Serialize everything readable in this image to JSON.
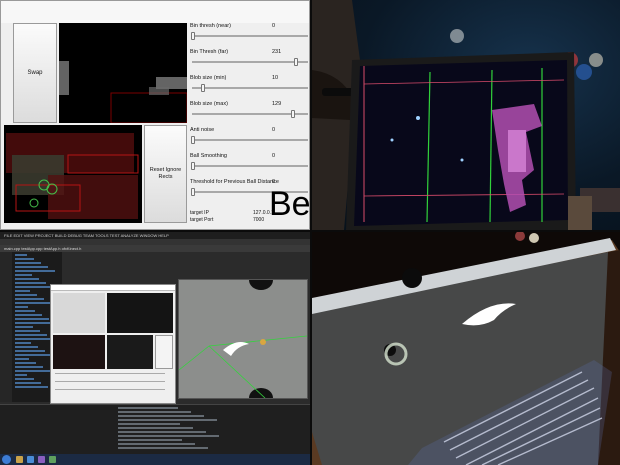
{
  "calibration_app": {
    "swap_label": "Swap",
    "reset_label": "Reset Ignore Rects",
    "params": [
      {
        "label": "Bin thresh (near)",
        "value": "0",
        "fraction": 0.0
      },
      {
        "label": "Bin Thresh (far)",
        "value": "231",
        "fraction": 0.9
      },
      {
        "label": "Blob size (min)",
        "value": "10",
        "fraction": 0.09
      },
      {
        "label": "Blob size (max)",
        "value": "129",
        "fraction": 0.88
      },
      {
        "label": "Anti noise",
        "value": "0",
        "fraction": 0.0
      },
      {
        "label": "Ball Smoothing",
        "value": "0",
        "fraction": 0.0
      },
      {
        "label": "Threshold for Previous Ball Distance",
        "value": "0",
        "fraction": 0.0
      }
    ],
    "target_ip_label": "target IP",
    "target_ip": "127.0.0.1",
    "target_port_label": "target Port",
    "target_port": "7000",
    "big_text": "Be"
  },
  "ide": {
    "menu": "FILE  EDIT  VIEW  PROJECT  BUILD  DEBUG  TEAM  TOOLS  TEST  ANALYZE  WINDOW  HELP",
    "tabs": "main.cpp   testApp.cpp   testApp.h   ofxKinect.h"
  },
  "colors": {
    "monitor_green": "#31d13b",
    "monitor_pink": "#d86cd2",
    "projection": "#e9ecef",
    "felt": "#474848"
  }
}
